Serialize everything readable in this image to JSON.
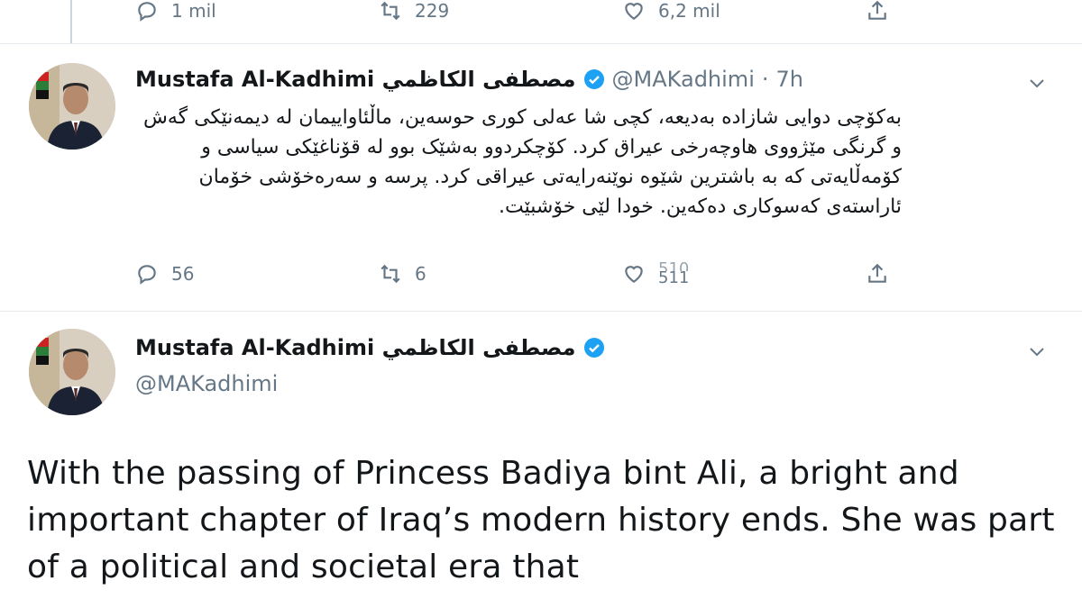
{
  "tweet0": {
    "actions": {
      "replies": "1 mil",
      "retweets": "229",
      "likes": "6,2 mil"
    }
  },
  "tweet1": {
    "name": "Mustafa Al-Kadhimi مصطفى الكاظمي",
    "handle": "@MAKadhimi",
    "separator": "·",
    "time": "7h",
    "text": "بەکۆچی دوایی شازادە بەدیعە، کچی شا عەلی کوری حوسەین، ماڵئاواییمان لە دیمەنێکی گەش و گرنگی مێژووی هاوچەرخی عیراق کرد. کۆچکردوو بەشێک بوو لە قۆناغێکی سیاسی و کۆمەڵایەتی کە بە باشترین شێوە نوێنەرایەتی عیراقی کرد. پرسە و سەرەخۆشی خۆمان ئاراستەی کەسوکاری دەکەین. خودا لێی خۆشبێت.",
    "actions": {
      "replies": "56",
      "retweets": "6",
      "likes_prev": "510",
      "likes": "511"
    }
  },
  "tweet2": {
    "name": "Mustafa Al-Kadhimi مصطفى الكاظمي",
    "handle": "@MAKadhimi",
    "text": "With the passing of Princess Badiya bint Ali, a bright and important chapter of Iraq’s modern history ends. She was part of a political and societal era that"
  },
  "icons": {
    "reply": "reply-icon",
    "retweet": "retweet-icon",
    "like": "heart-icon",
    "share": "share-icon",
    "verified": "verified-badge-icon",
    "more": "chevron-down-icon"
  },
  "colors": {
    "verified_blue": "#1da1f2",
    "muted_gray": "#657786",
    "text_dark": "#14171a"
  }
}
